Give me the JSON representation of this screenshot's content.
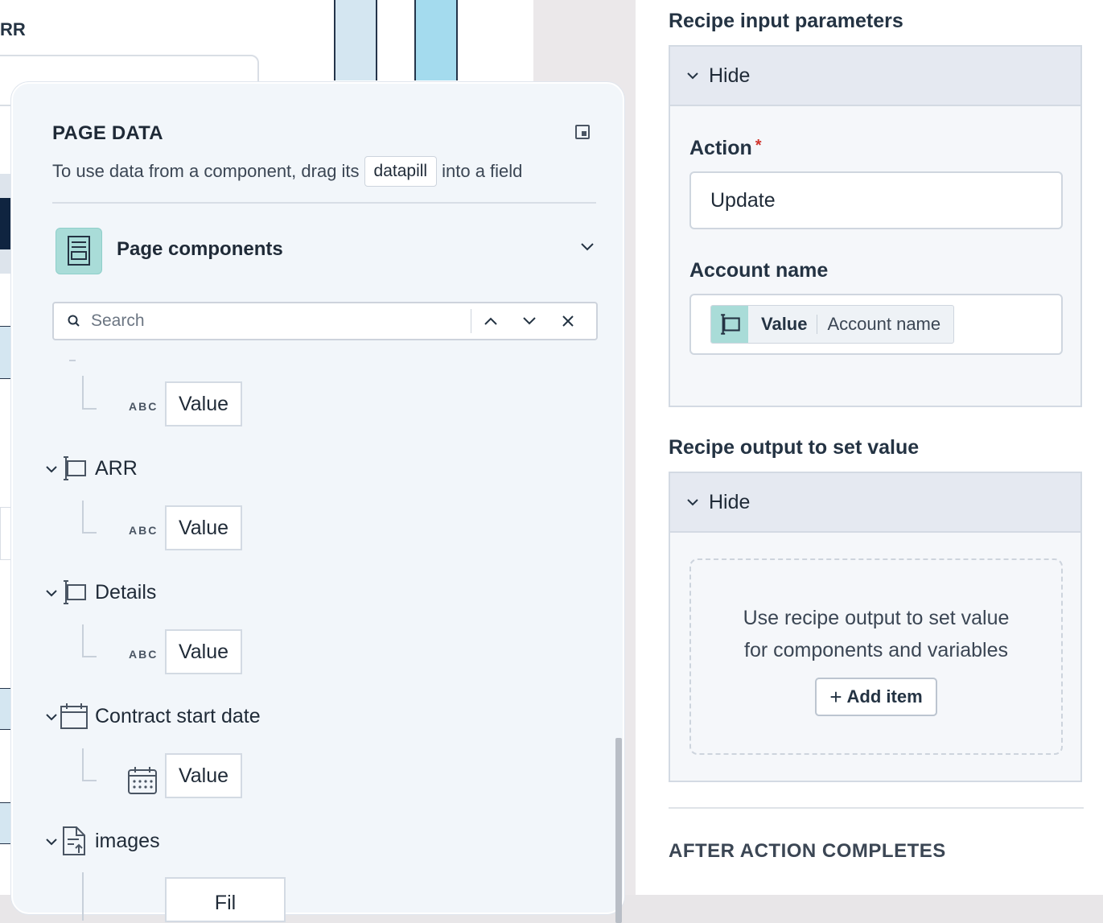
{
  "canvas": {
    "label": "RR"
  },
  "page_data_panel": {
    "title": "PAGE DATA",
    "subtitle_before": "To use data from a component, drag its",
    "subtitle_chip": "datapill",
    "subtitle_after": "into a field",
    "section_title": "Page components",
    "search": {
      "placeholder": "Search",
      "value": ""
    },
    "abc_label": "ABC",
    "tree": [
      {
        "name": "",
        "child_value": "Value",
        "child_type": "text"
      },
      {
        "name": "ARR",
        "child_value": "Value",
        "child_type": "text"
      },
      {
        "name": "Details",
        "child_value": "Value",
        "child_type": "text"
      },
      {
        "name": "Contract start date",
        "child_value": "Value",
        "child_type": "date"
      },
      {
        "name": "images",
        "child_value": "Fil",
        "child_type": "file"
      }
    ]
  },
  "right_panel": {
    "input_params": {
      "heading": "Recipe input parameters",
      "toggle_label": "Hide",
      "action_label": "Action",
      "required_mark": "*",
      "action_value": "Update",
      "account_label": "Account name",
      "datapill_name": "Value",
      "datapill_value": "Account name"
    },
    "output": {
      "heading": "Recipe output to set value",
      "toggle_label": "Hide",
      "empty_line1": "Use recipe output to set value",
      "empty_line2": "for components and variables",
      "add_button": "Add item",
      "add_symbol": "+"
    },
    "after_heading": "AFTER ACTION COMPLETES"
  },
  "colors": {
    "accent_teal": "#a9dcd8",
    "required_red": "#d0342c",
    "chart_bar_light": "#d4e6f1",
    "chart_bar_mid": "#a4dbee"
  }
}
